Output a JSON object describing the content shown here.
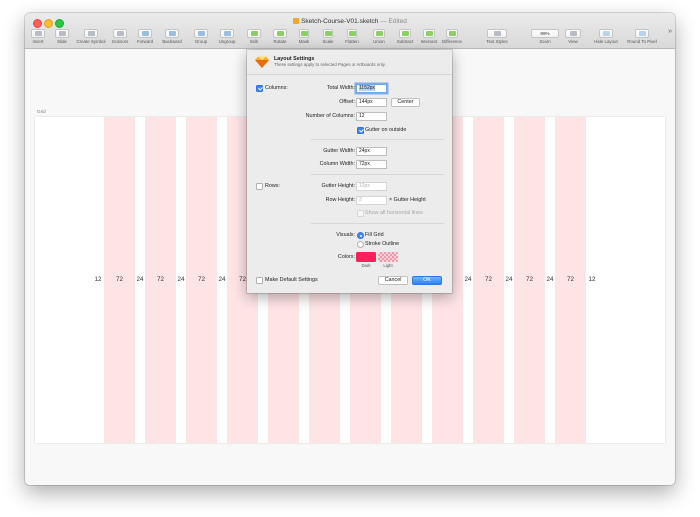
{
  "window": {
    "title": "Sketch-Course-V01.sketch",
    "title_suffix": "— Edited"
  },
  "toolbar": {
    "items": [
      {
        "label": "Insert",
        "icon": "plus-icon"
      },
      {
        "label": "Slide",
        "icon": "slide-icon"
      },
      {
        "label": "Create Symbol",
        "icon": "symbol-icon"
      },
      {
        "label": "Scissors",
        "icon": "scissors-icon"
      },
      {
        "label": "Forward",
        "icon": "forward-icon"
      },
      {
        "label": "Backward",
        "icon": "backward-icon"
      },
      {
        "label": "Group",
        "icon": "group-icon"
      },
      {
        "label": "Ungroup",
        "icon": "ungroup-icon"
      },
      {
        "label": "Edit",
        "icon": "edit-icon"
      },
      {
        "label": "Rotate",
        "icon": "rotate-icon"
      },
      {
        "label": "Mask",
        "icon": "mask-icon"
      },
      {
        "label": "Scale",
        "icon": "scale-icon"
      },
      {
        "label": "Flatten",
        "icon": "flatten-icon"
      },
      {
        "label": "Union",
        "icon": "union-icon"
      },
      {
        "label": "Subtract",
        "icon": "subtract-icon"
      },
      {
        "label": "Intersect",
        "icon": "intersect-icon"
      },
      {
        "label": "Difference",
        "icon": "difference-icon"
      },
      {
        "label": "Text Styles",
        "icon": "text-styles-icon"
      },
      {
        "label": "Zoom",
        "icon": "zoom-icon"
      },
      {
        "label": "View",
        "icon": "view-icon"
      },
      {
        "label": "Hide Layout",
        "icon": "hide-layout-icon"
      },
      {
        "label": "Round To Pixel",
        "icon": "round-to-pixel-icon"
      }
    ],
    "zoom_value": "99%",
    "overflow": "»"
  },
  "canvas": {
    "artboard_label": "Grid",
    "gutter_label": "24",
    "column_label": "72",
    "offset_label": "12",
    "column_color": "#ffe4e6"
  },
  "dialog": {
    "title": "Layout Settings",
    "subtitle": "These settings apply to selected Pages or Artboards only.",
    "columns_label": "Columns:",
    "total_width_label": "Total Width:",
    "total_width_value": "1152px",
    "offset_label": "Offset:",
    "offset_value": "144px",
    "center_button": "Center",
    "num_columns_label": "Number of Columns:",
    "num_columns_value": "12",
    "gutter_outside_label": "Gutter on outside",
    "gutter_width_label": "Gutter Width:",
    "gutter_width_value": "24px",
    "column_width_label": "Column Width:",
    "column_width_value": "72px",
    "rows_label": "Rows:",
    "gutter_height_label": "Gutter Height:",
    "gutter_height_value": "12px",
    "row_height_label": "Row Height:",
    "row_height_value": "3",
    "row_height_suffix": "× Gutter Height",
    "show_horizontal_label": "Show all horizontal lines",
    "visuals_label": "Visuals:",
    "fill_grid_label": "Fill Grid",
    "stroke_outline_label": "Stroke Outline",
    "colors_label": "Colors:",
    "dark_label": "Dark",
    "light_label": "Light",
    "dark_color": "#fc1f5a",
    "make_default_label": "Make Default Settings",
    "cancel_button": "Cancel",
    "ok_button": "OK"
  }
}
